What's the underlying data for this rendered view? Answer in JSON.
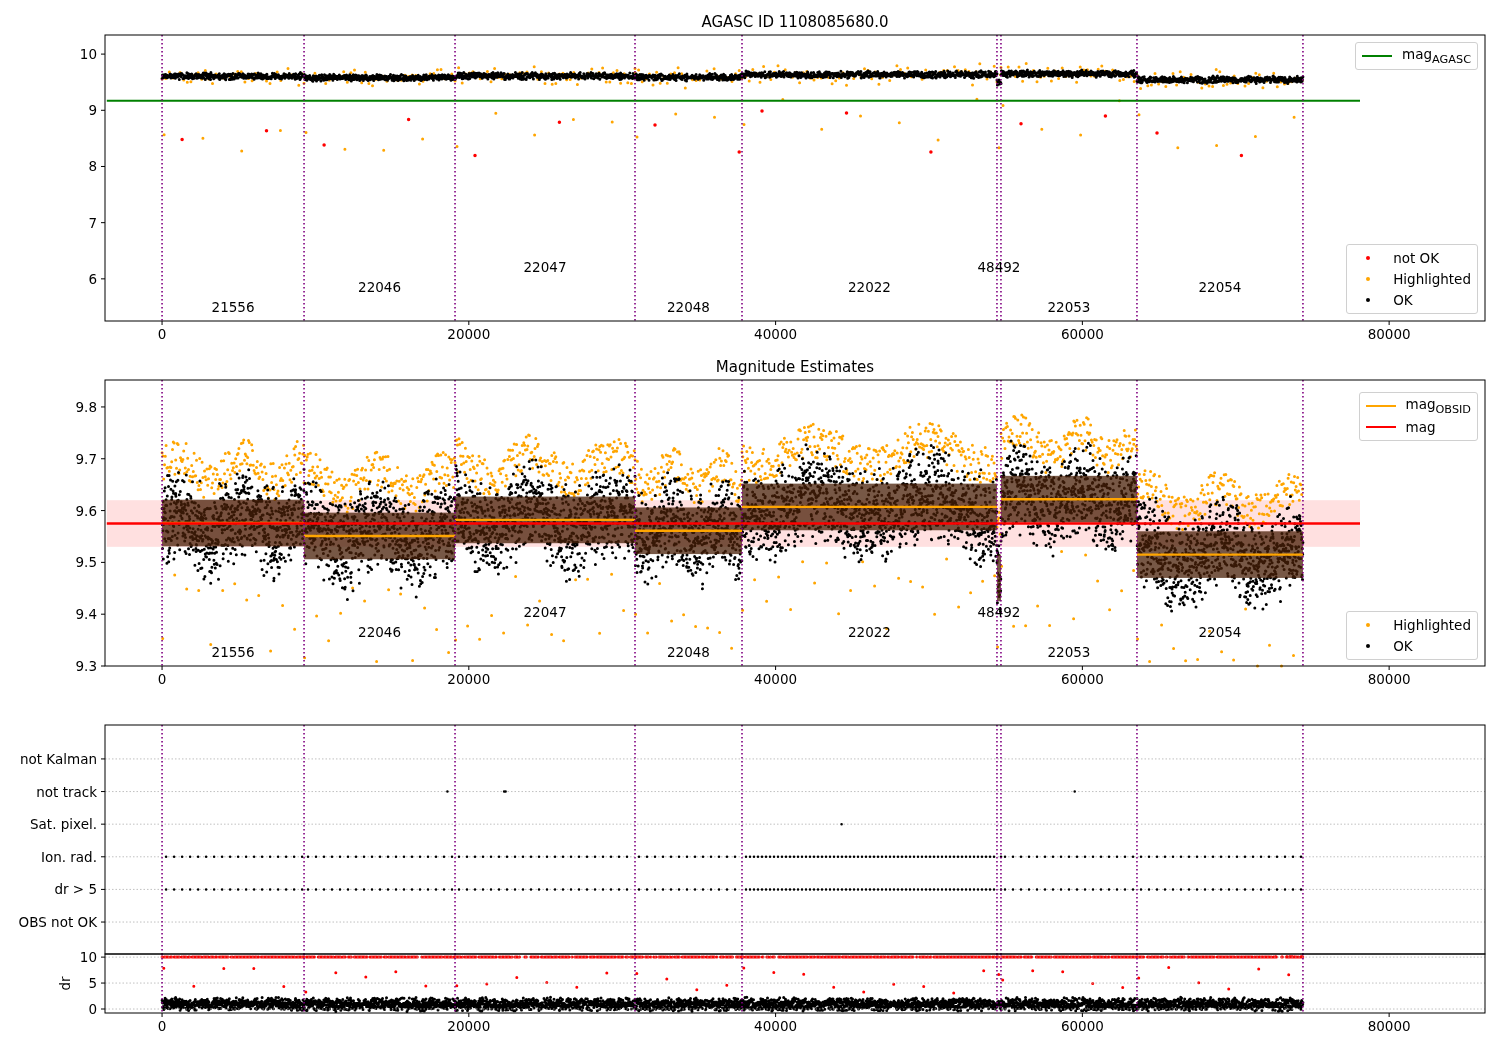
{
  "figure": {
    "panels": [
      {
        "chart_data": {
          "type": "line",
          "title": "AGASC ID 1108085680.0",
          "xlim": [
            -3720,
            86250
          ],
          "ylim": [
            5.25,
            10.34
          ],
          "xticks": [
            0,
            20000,
            40000,
            60000,
            80000
          ],
          "yticks": [
            6,
            7,
            8,
            9,
            10
          ],
          "x": [
            -3600,
            78100
          ],
          "series": [
            {
              "name": "mag$_{AGASC}$",
              "color": "#008000",
              "values": [
                9.17,
                9.17
              ]
            }
          ],
          "legend": "upper right",
          "ref_lines": [
            {
              "axis": "x",
              "value": 0
            },
            {
              "axis": "x",
              "value": 9257
            },
            {
              "axis": "x",
              "value": 19100
            },
            {
              "axis": "x",
              "value": 30834
            },
            {
              "axis": "x",
              "value": 37810
            },
            {
              "axis": "x",
              "value": 54432
            },
            {
              "axis": "x",
              "value": 54693
            },
            {
              "axis": "x",
              "value": 63559
            },
            {
              "axis": "x",
              "value": 74381
            }
          ],
          "annotations": [
            "21556",
            "22046",
            "22047",
            "22048",
            "22022",
            "48492",
            "22053",
            "22054"
          ]
        },
        "marker_legend": [
          {
            "label": "not OK",
            "color": "#ff0000"
          },
          {
            "label": "Highlighted",
            "color": "#ffa500"
          },
          {
            "label": "OK",
            "color": "#000000"
          }
        ]
      },
      {
        "chart_data": {
          "type": "line",
          "title": "Magnitude Estimates",
          "xlim": [
            -3720,
            86250
          ],
          "ylim": [
            9.3,
            9.852
          ],
          "xticks": [
            0,
            20000,
            40000,
            60000,
            80000
          ],
          "yticks": [
            9.3,
            9.4,
            9.5,
            9.6,
            9.7,
            9.8
          ],
          "x": [
            -3600,
            0,
            9257,
            9257,
            19100,
            19100,
            30834,
            30834,
            37810,
            37810,
            54432,
            54693,
            63559,
            63559,
            74381,
            78100
          ],
          "series": [
            {
              "name": "mag$_{OBSID}$",
              "color": "#ffa500",
              "values": [
                null,
                9.576,
                9.576,
                9.551,
                9.551,
                9.582,
                9.582,
                9.561,
                9.561,
                9.607,
                9.607,
                9.622,
                9.622,
                9.515,
                9.515,
                null
              ]
            },
            {
              "name": "mag",
              "color": "#ff0000",
              "values": [
                9.575,
                9.575,
                9.575,
                9.575,
                9.575,
                9.575,
                9.575,
                9.575,
                9.575,
                9.575,
                9.575,
                9.575,
                9.575,
                9.575,
                9.575,
                9.575
              ]
            }
          ],
          "bands": [
            {
              "axis": "y",
              "from": 9.53,
              "to": 9.62,
              "color": "#ffe0e0"
            }
          ],
          "legend": "upper right",
          "ref_lines": [
            {
              "axis": "x",
              "value": 0
            },
            {
              "axis": "x",
              "value": 9257
            },
            {
              "axis": "x",
              "value": 19100
            },
            {
              "axis": "x",
              "value": 30834
            },
            {
              "axis": "x",
              "value": 37810
            },
            {
              "axis": "x",
              "value": 54432
            },
            {
              "axis": "x",
              "value": 54693
            },
            {
              "axis": "x",
              "value": 63559
            },
            {
              "axis": "x",
              "value": 74381
            }
          ],
          "annotations": [
            "21556",
            "22046",
            "22047",
            "22048",
            "22022",
            "48492",
            "22053",
            "22054"
          ]
        },
        "marker_legend": [
          {
            "label": "Highlighted",
            "color": "#ffa500"
          },
          {
            "label": "OK",
            "color": "#000000"
          }
        ]
      },
      {
        "chart_data": {
          "type": "scatter",
          "xlim": [
            -3720,
            86250
          ],
          "grid": true,
          "orientation": "horizontal",
          "categories": [
            "not Kalman",
            "not track",
            "Sat. pixel.",
            "Ion. rad.",
            "dr > 5",
            "OBS not OK"
          ],
          "ref_lines": [
            {
              "axis": "x",
              "value": 0
            },
            {
              "axis": "x",
              "value": 9257
            },
            {
              "axis": "x",
              "value": 19100
            },
            {
              "axis": "x",
              "value": 30834
            },
            {
              "axis": "x",
              "value": 37810
            },
            {
              "axis": "x",
              "value": 54432
            },
            {
              "axis": "x",
              "value": 54693
            },
            {
              "axis": "x",
              "value": 63559
            },
            {
              "axis": "x",
              "value": 74381
            }
          ]
        }
      },
      {
        "chart_data": {
          "type": "scatter",
          "ylabel": "dr",
          "xlim": [
            -3720,
            86250
          ],
          "ylim": [
            -0.77,
            10.6
          ],
          "grid": true,
          "xticks": [
            0,
            20000,
            40000,
            60000,
            80000
          ],
          "yticks": [
            0,
            5,
            10
          ],
          "ref_lines": [
            {
              "axis": "x",
              "value": 0
            },
            {
              "axis": "x",
              "value": 9257
            },
            {
              "axis": "x",
              "value": 19100
            },
            {
              "axis": "x",
              "value": 30834
            },
            {
              "axis": "x",
              "value": 37810
            },
            {
              "axis": "x",
              "value": 54432
            },
            {
              "axis": "x",
              "value": 54693
            },
            {
              "axis": "x",
              "value": 63559
            },
            {
              "axis": "x",
              "value": 74381
            }
          ]
        }
      }
    ]
  }
}
